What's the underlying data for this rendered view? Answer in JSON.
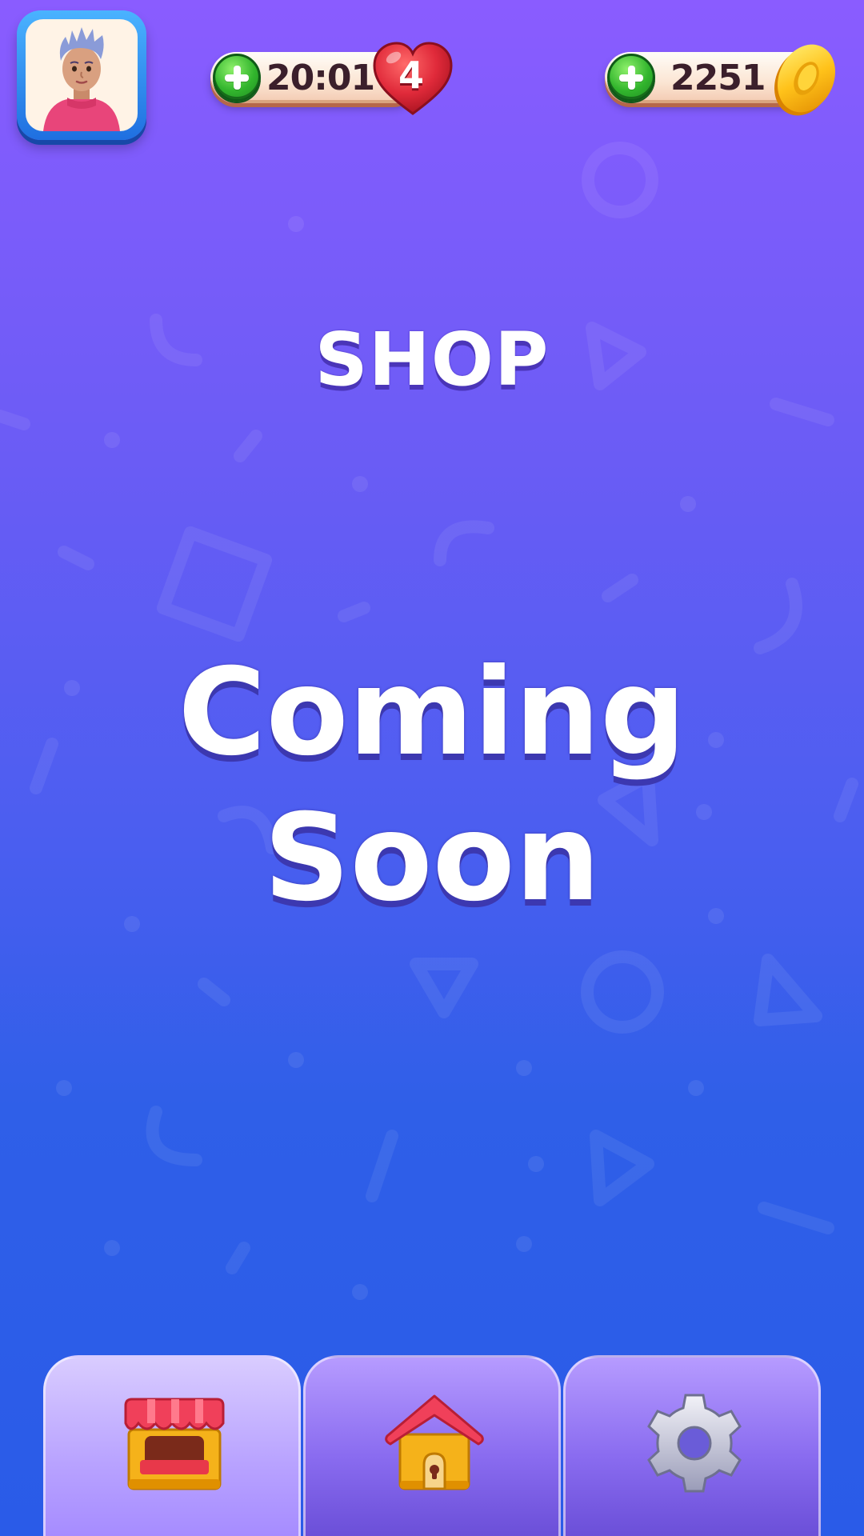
{
  "topbar": {
    "lives_timer": "20:01",
    "lives_count": "4",
    "coins": "2251"
  },
  "screen": {
    "title": "SHOP",
    "message_line1": "Coming",
    "message_line2": "Soon"
  },
  "nav": {
    "tabs": [
      {
        "name": "shop",
        "icon": "shop-icon",
        "active": true
      },
      {
        "name": "home",
        "icon": "home-icon",
        "active": false
      },
      {
        "name": "settings",
        "icon": "gear-icon",
        "active": false
      }
    ]
  },
  "colors": {
    "background_top": "#8a5cff",
    "background_bottom": "#2a5be8",
    "heart": "#e02a3a",
    "coin": "#ffc21a",
    "plus_button": "#32b52d"
  }
}
